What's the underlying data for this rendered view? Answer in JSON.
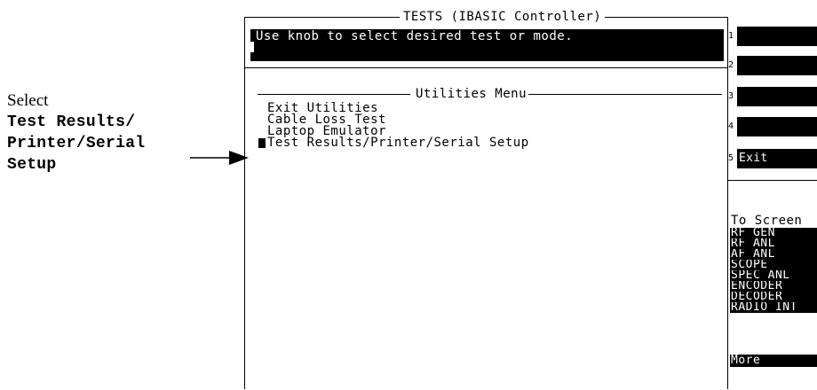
{
  "annotation": {
    "intro": "Select",
    "command_lines": [
      "Test Results/",
      "Printer/Serial",
      "Setup"
    ]
  },
  "screen": {
    "title": "TESTS (IBASIC Controller)",
    "prompt": "Use knob to select desired test or mode.",
    "menu_title": "Utilities Menu",
    "menu_items": [
      "Exit Utilities",
      "Cable Loss Test",
      "Laptop Emulator",
      "Test Results/Printer/Serial Setup"
    ],
    "selected_index": 3
  },
  "softkeys": [
    {
      "number": "1",
      "label": ""
    },
    {
      "number": "2",
      "label": ""
    },
    {
      "number": "3",
      "label": ""
    },
    {
      "number": "4",
      "label": ""
    },
    {
      "number": "5",
      "label": "Exit"
    }
  ],
  "to_screen": {
    "label": "To Screen",
    "items": [
      "RF GEN",
      "RF ANL",
      "AF ANL",
      "SCOPE",
      "SPEC ANL",
      "ENCODER",
      "DECODER",
      "RADIO INT"
    ],
    "more_label": "More"
  }
}
